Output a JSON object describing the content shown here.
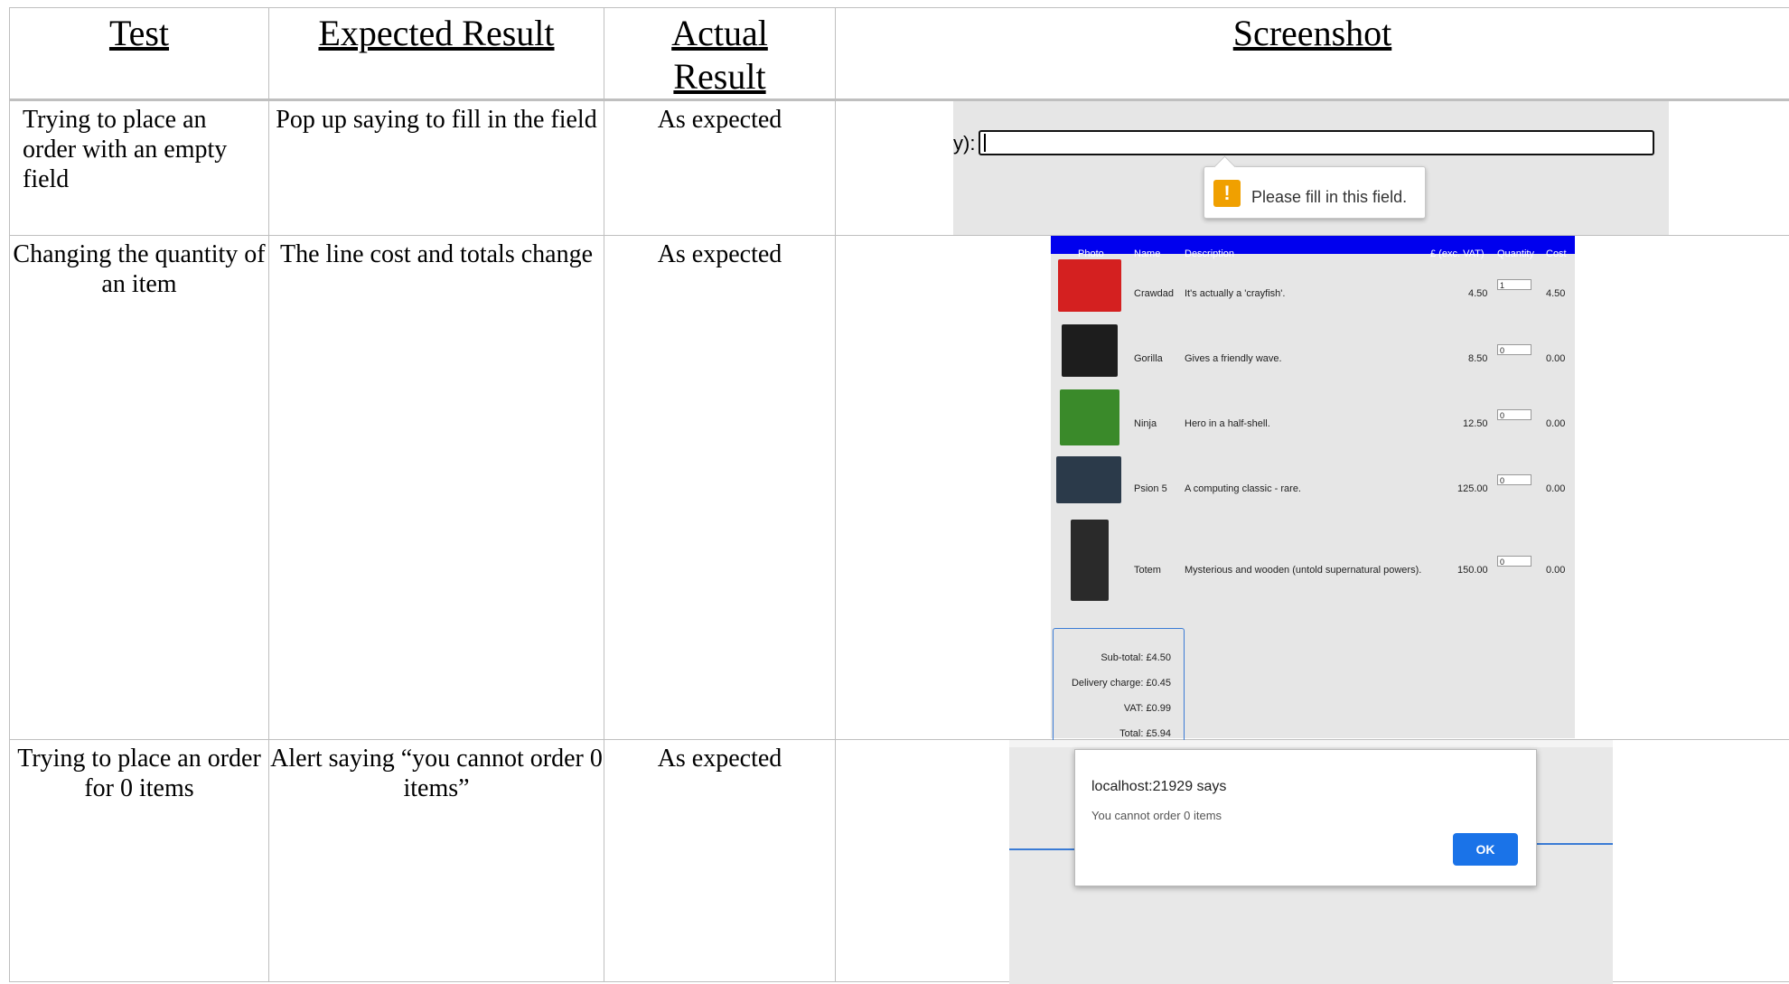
{
  "table": {
    "headers": [
      "Test",
      "Expected Result",
      "Actual Result",
      "Screenshot"
    ],
    "rows": [
      {
        "test": "Trying to place an order with an empty field",
        "expected": "Pop up saying to fill in the field",
        "actual": "As expected"
      },
      {
        "test": "Changing the quantity of an item",
        "expected": "The line cost and totals change",
        "actual": "As expected"
      },
      {
        "test": "Trying to place an order for 0 items",
        "expected": "Alert saying “you cannot order 0 items”",
        "actual": "As expected"
      }
    ]
  },
  "shot1": {
    "label": "y):",
    "tooltip": "Please fill in this field.",
    "warn_icon": "!"
  },
  "shot2": {
    "columns": [
      "Photo",
      "Name",
      "Description",
      "£ (exc. VAT)",
      "Quantity",
      "Cost"
    ],
    "products": [
      {
        "name": "Crawdad",
        "description": "It's actually a 'crayfish'.",
        "price": "4.50",
        "quantity": "1",
        "cost": "4.50",
        "photo_color": "#d42020"
      },
      {
        "name": "Gorilla",
        "description": "Gives a friendly wave.",
        "price": "8.50",
        "quantity": "0",
        "cost": "0.00",
        "photo_color": "#1d1d1d"
      },
      {
        "name": "Ninja",
        "description": "Hero in a half-shell.",
        "price": "12.50",
        "quantity": "0",
        "cost": "0.00",
        "photo_color": "#3a8a2a"
      },
      {
        "name": "Psion 5",
        "description": "A computing classic - rare.",
        "price": "125.00",
        "quantity": "0",
        "cost": "0.00",
        "photo_color": "#2b3a4a"
      },
      {
        "name": "Totem",
        "description": "Mysterious and wooden (untold supernatural powers).",
        "price": "150.00",
        "quantity": "0",
        "cost": "0.00",
        "photo_color": "#2a2a2a"
      }
    ],
    "totals": {
      "subtotal": "Sub-total: £4.50",
      "delivery": "Delivery charge: £0.45",
      "vat": "VAT: £0.99",
      "total": "Total: £5.94"
    }
  },
  "shot3": {
    "dialog_title": "localhost:21929 says",
    "dialog_message": "You cannot order 0 items",
    "ok_label": "OK",
    "accent": "#1a73e8"
  }
}
